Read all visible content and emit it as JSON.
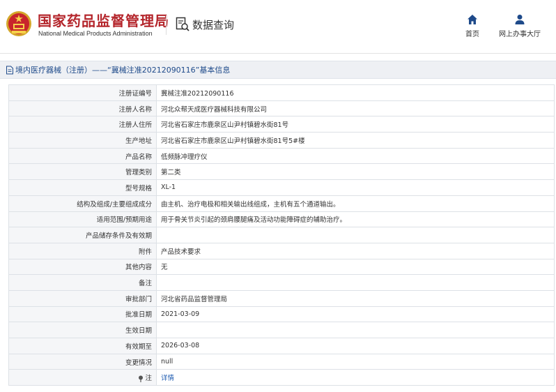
{
  "header": {
    "brand_cn": "国家药品监督管理局",
    "brand_en": "National Medical Products Administration",
    "query_label": "数据查询",
    "nav": [
      {
        "label": "首页",
        "icon": "home-icon"
      },
      {
        "label": "网上办事大厅",
        "icon": "user-icon"
      }
    ]
  },
  "titlebar": {
    "text": "境内医疗器械（注册）——“冀械注准20212090116”基本信息"
  },
  "rows": [
    {
      "key": "注册证编号",
      "value": "冀械注准20212090116"
    },
    {
      "key": "注册人名称",
      "value": "河北众帮天成医疗器械科技有限公司"
    },
    {
      "key": "注册人住所",
      "value": "河北省石家庄市鹿泉区山尹村镇碧水街81号"
    },
    {
      "key": "生产地址",
      "value": "河北省石家庄市鹿泉区山尹村镇碧水街81号5#楼"
    },
    {
      "key": "产品名称",
      "value": "低频脉冲理疗仪"
    },
    {
      "key": "管理类别",
      "value": "第二类"
    },
    {
      "key": "型号规格",
      "value": "XL-1"
    },
    {
      "key": "结构及组成/主要组成成分",
      "value": "由主机、治疗电极和相关输出线组成，主机有五个通道输出。"
    },
    {
      "key": "适用范围/预期用途",
      "value": "用于骨关节炎引起的颈肩腰腿痛及活动功能障碍症的辅助治疗。"
    },
    {
      "key": "产品储存条件及有效期",
      "value": ""
    },
    {
      "key": "附件",
      "value": "产品技术要求"
    },
    {
      "key": "其他内容",
      "value": "无"
    },
    {
      "key": "备注",
      "value": ""
    },
    {
      "key": "审批部门",
      "value": "河北省药品监督管理局"
    },
    {
      "key": "批准日期",
      "value": "2021-03-09"
    },
    {
      "key": "生效日期",
      "value": ""
    },
    {
      "key": "有效期至",
      "value": "2026-03-08"
    },
    {
      "key": "变更情况",
      "value": "null"
    },
    {
      "key": "注",
      "value": "详情"
    }
  ],
  "colors": {
    "brand_red": "#b4252b",
    "nav_blue": "#1e4a8a",
    "link_blue": "#1e5bb0"
  }
}
